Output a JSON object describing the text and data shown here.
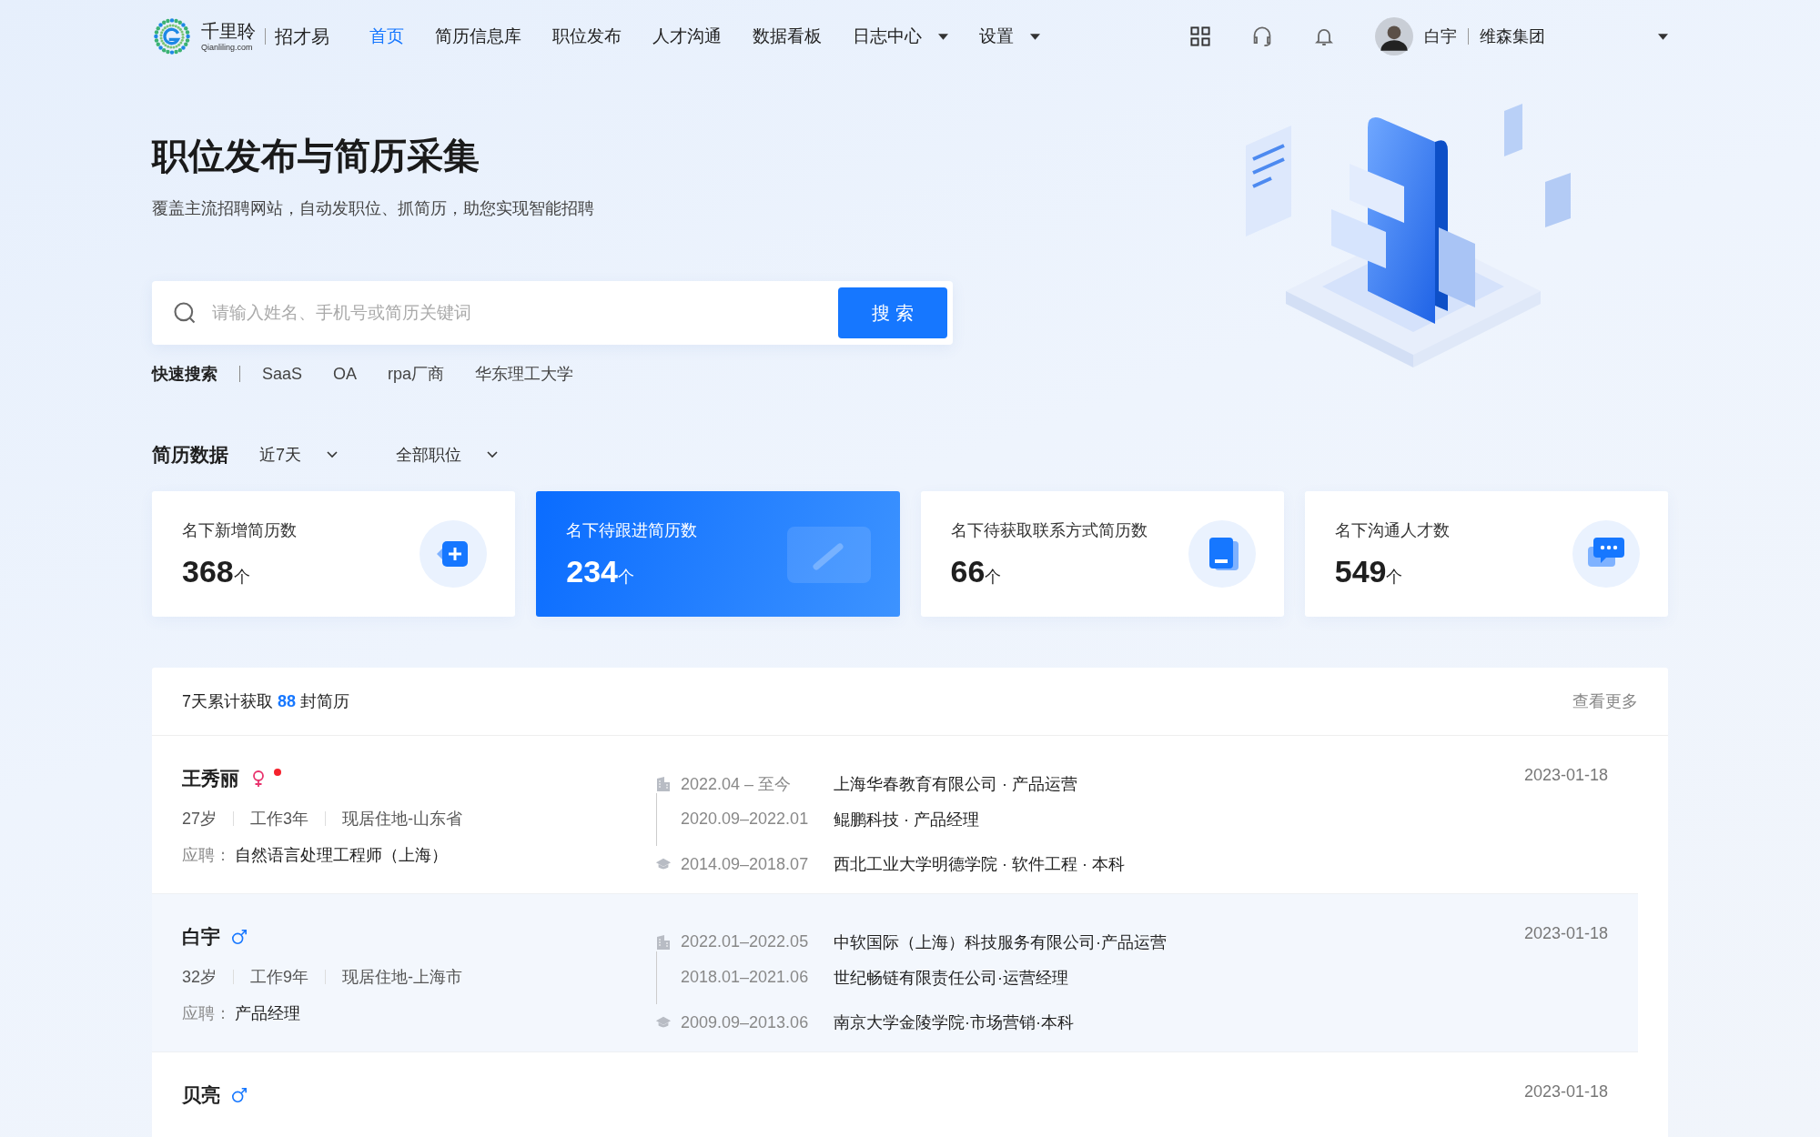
{
  "brand": {
    "name": "千里聆",
    "product": "招才易",
    "domain": "Qianliling.com"
  },
  "nav": [
    {
      "label": "首页",
      "selected": true,
      "dropdown": false
    },
    {
      "label": "简历信息库",
      "selected": false,
      "dropdown": false
    },
    {
      "label": "职位发布",
      "selected": false,
      "dropdown": false
    },
    {
      "label": "人才沟通",
      "selected": false,
      "dropdown": false
    },
    {
      "label": "数据看板",
      "selected": false,
      "dropdown": false
    },
    {
      "label": "日志中心",
      "selected": false,
      "dropdown": true
    },
    {
      "label": "设置",
      "selected": false,
      "dropdown": true
    }
  ],
  "user": {
    "name": "白宇",
    "company": "维森集团"
  },
  "hero": {
    "title": "职位发布与简历采集",
    "subtitle": "覆盖主流招聘网站，自动发职位、抓简历，助您实现智能招聘"
  },
  "search": {
    "placeholder": "请输入姓名、手机号或简历关键词",
    "button": "搜 索"
  },
  "quick_search": {
    "label": "快速搜索",
    "items": [
      "SaaS",
      "OA",
      "rpa厂商",
      "华东理工大学"
    ]
  },
  "stats": {
    "title": "简历数据",
    "filters": [
      "近7天",
      "全部职位"
    ],
    "cards": [
      {
        "label": "名下新增简历数",
        "value": "368",
        "unit": "个",
        "kind": "plus",
        "selected": false
      },
      {
        "label": "名下待跟进简历数",
        "value": "234",
        "unit": "个",
        "kind": "edit",
        "selected": true
      },
      {
        "label": "名下待获取联系方式简历数",
        "value": "66",
        "unit": "个",
        "kind": "book",
        "selected": false
      },
      {
        "label": "名下沟通人才数",
        "value": "549",
        "unit": "个",
        "kind": "chat",
        "selected": false
      }
    ]
  },
  "list": {
    "prefix": "7天累计获取",
    "count": "88",
    "suffix": "封简历",
    "more": "查看更多",
    "rows": [
      {
        "name": "王秀丽",
        "kind": "female",
        "new": true,
        "selected": false,
        "age": "27岁",
        "experience": "工作3年",
        "location": "现居住地-山东省",
        "apply_label": "应聘：",
        "apply": "自然语言处理工程师（上海）",
        "date": "2023-01-18",
        "work": [
          {
            "period": "2022.04 – 至今",
            "text": "上海华春教育有限公司 · 产品运营"
          },
          {
            "period": "2020.09–2022.01",
            "text": "鲲鹏科技 · 产品经理"
          }
        ],
        "education": [
          {
            "period": "2014.09–2018.07",
            "text": "西北工业大学明德学院 · 软件工程 · 本科"
          }
        ]
      },
      {
        "name": "白宇",
        "kind": "male",
        "new": false,
        "selected": true,
        "age": "32岁",
        "experience": "工作9年",
        "location": "现居住地-上海市",
        "apply_label": "应聘：",
        "apply": "产品经理",
        "date": "2023-01-18",
        "work": [
          {
            "period": "2022.01–2022.05",
            "text": "中软国际（上海）科技服务有限公司·产品运营"
          },
          {
            "period": "2018.01–2021.06",
            "text": "世纪畅链有限责任公司·运营经理"
          }
        ],
        "education": [
          {
            "period": "2009.09–2013.06",
            "text": "南京大学金陵学院·市场营销·本科"
          }
        ]
      },
      {
        "name": "贝亮",
        "kind": "male",
        "new": false,
        "selected": false,
        "date": "2023-01-18"
      }
    ]
  }
}
